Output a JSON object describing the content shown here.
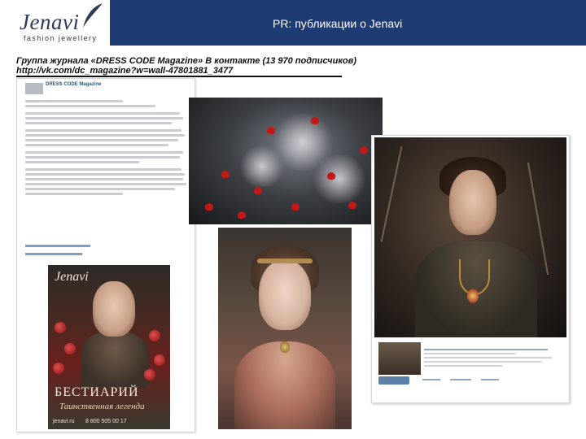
{
  "header": {
    "logo_brand": "Jenavi",
    "logo_tagline": "fashion jewellery",
    "title": "PR: публикации о Jenavi",
    "colors": {
      "bar": "#1f3b73",
      "logo_text": "#2b3a55"
    }
  },
  "caption": {
    "line1": "Группа журнала «DRESS CODE Magazine» В контакте (13 970 подписчиков)",
    "line2": "http://vk.com/dc_magazine?w=wall-47801881_3477"
  },
  "vk_post": {
    "group_name": "DRESS CODE Magazine",
    "cover": {
      "logo": "Jenavi",
      "title": "БЕСТИАРИЙ",
      "subtitle": "Таинственная легенда",
      "url": "jenavi.ru",
      "phone": "8 800 505 00 17"
    }
  }
}
